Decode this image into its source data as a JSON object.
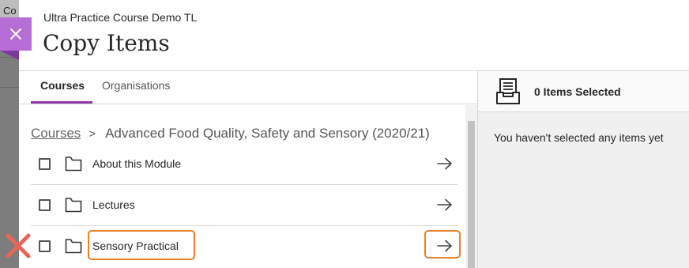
{
  "background": {
    "text": "Co"
  },
  "header": {
    "subtitle": "Ultra Practice Course Demo TL",
    "title": "Copy Items"
  },
  "tabs": [
    {
      "label": "Courses",
      "active": true
    },
    {
      "label": "Organisations",
      "active": false
    }
  ],
  "breadcrumb": {
    "root": "Courses",
    "separator": ">",
    "current": "Advanced Food Quality, Safety and Sensory (2020/21)"
  },
  "items": [
    {
      "label": "About this Module",
      "icon": "folder-icon",
      "checked": false
    },
    {
      "label": "Lectures",
      "icon": "folder-icon",
      "checked": false
    },
    {
      "label": "Sensory Practical",
      "icon": "folder-icon",
      "checked": false
    }
  ],
  "selection": {
    "count_label": "0 Items Selected",
    "empty_message": "You haven't selected any items yet"
  },
  "colors": {
    "accent": "#8c3ba8",
    "close_button": "#b66dd6",
    "highlight": "#e8812c",
    "x_mark": "#e8655a"
  }
}
